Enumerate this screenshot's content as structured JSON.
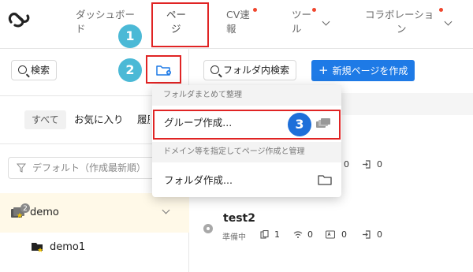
{
  "nav": {
    "items": [
      {
        "label_line1": "ダッシュボー",
        "label_line2": "ド"
      },
      {
        "label_line1": "ペー",
        "label_line2": "ジ"
      },
      {
        "label_line1": "CV速",
        "label_line2": "報"
      },
      {
        "label_line1": "ツー",
        "label_line2": "ル"
      },
      {
        "label_line1": "コラボレーショ",
        "label_line2": "ン"
      }
    ]
  },
  "steps": {
    "one": "1",
    "two": "2",
    "three": "3"
  },
  "left": {
    "search_label": "検索",
    "tabs": {
      "all": "すべて",
      "favorites": "お気に入り",
      "history": "履歴"
    },
    "sort_label": "デフォルト（作成最新順）",
    "group": {
      "name": "demo",
      "badge": "2"
    },
    "sub_item": {
      "name": "demo1"
    }
  },
  "right": {
    "folder_search_label": "フォルダ内検索",
    "new_page_label": "新規ページを作成",
    "new_page_plus": "+",
    "bg_stats": {
      "a": "0",
      "b": "0"
    },
    "page": {
      "title": "test2",
      "status": "準備中",
      "stats": {
        "pages": "1",
        "wifi": "0",
        "ab": "0",
        "exit": "0"
      }
    }
  },
  "dropdown": {
    "group_header": "フォルダまとめて整理",
    "group_create": "グループ作成...",
    "folder_header": "ドメイン等を指定してページ作成と管理",
    "folder_create": "フォルダ作成..."
  },
  "colors": {
    "accent_red": "#e02424",
    "primary_blue": "#1e7ae6",
    "step_teal": "#4bb9d6",
    "step_blue": "#1e6fd9",
    "notification": "#f0462d",
    "highlight_row": "#fff9e8"
  }
}
